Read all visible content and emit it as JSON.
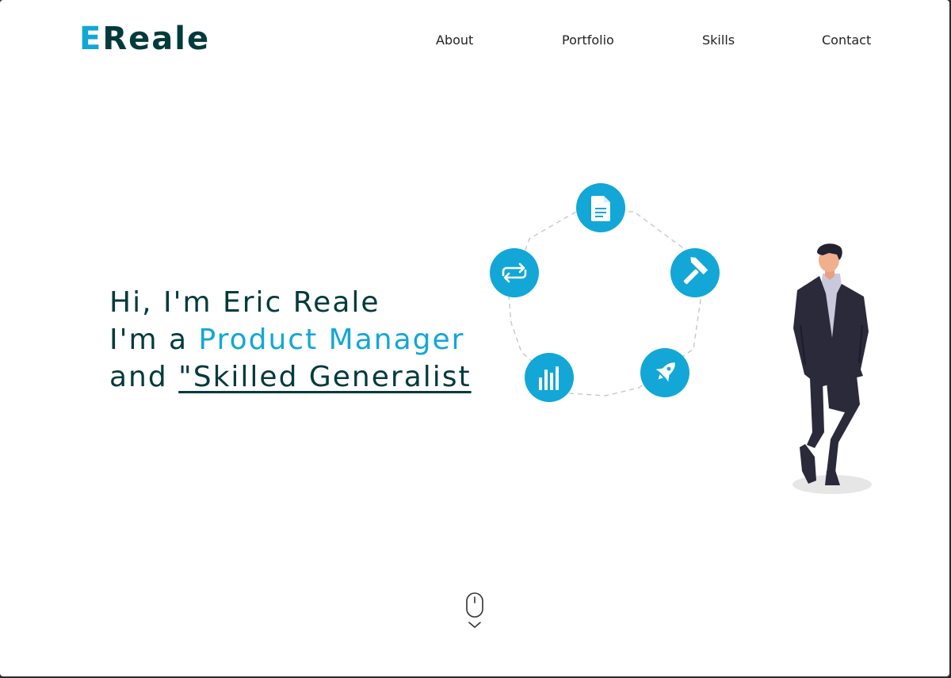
{
  "brand": {
    "first_letter": "E",
    "rest": "Reale",
    "accent_color": "#12a7d6",
    "primary_color": "#033a3c"
  },
  "nav": {
    "about": "About",
    "portfolio": "Portfolio",
    "skills": "Skills",
    "contact": "Contact"
  },
  "hero": {
    "greeting": "Hi, I'm Eric Reale",
    "role_prefix": "I'm a ",
    "role": "Product Manager",
    "generalist_prefix": "and ",
    "generalist": "\"Skilled Generalist"
  },
  "cycle_icons": [
    "document-icon",
    "hammer-icon",
    "rocket-icon",
    "bar-chart-icon",
    "repeat-icon"
  ],
  "scroll_hint": "mouse-scroll-icon"
}
